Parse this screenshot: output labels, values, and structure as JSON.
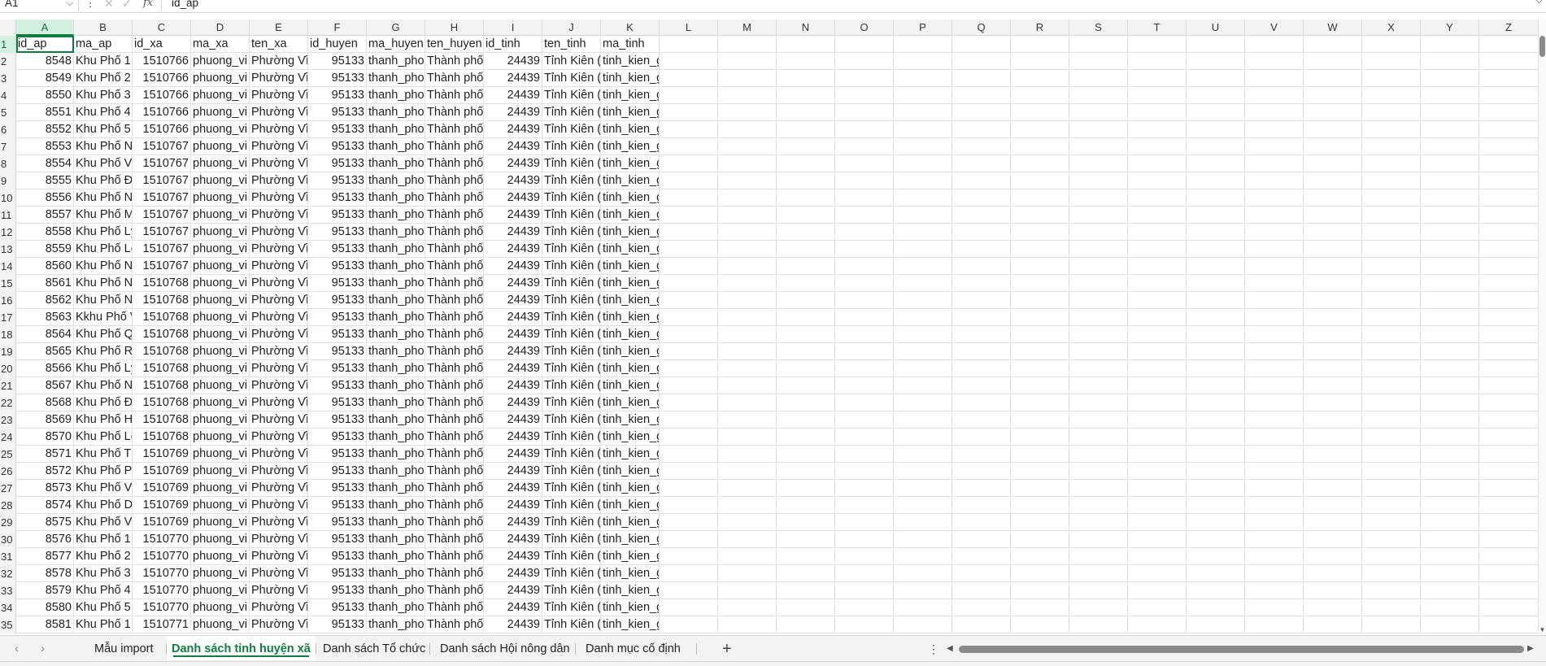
{
  "formula_bar": {
    "name_box": "A1",
    "formula": "id_ap",
    "dots": "⋮",
    "cancel_icon": "close-icon",
    "enter_icon": "check-icon",
    "fx_label": "fx"
  },
  "columns": [
    "A",
    "B",
    "C",
    "D",
    "E",
    "F",
    "G",
    "H",
    "I",
    "J",
    "K",
    "L",
    "M",
    "N",
    "O",
    "P",
    "Q",
    "R",
    "S",
    "T",
    "U",
    "V",
    "W",
    "X",
    "Y",
    "Z"
  ],
  "headers": [
    "id_ap",
    "ma_ap",
    "id_xa",
    "ma_xa",
    "ten_xa",
    "id_huyen",
    "ma_huyen",
    "ten_huyen",
    "id_tinh",
    "ten_tinh",
    "ma_tinh"
  ],
  "rows": [
    [
      "8548",
      "Khu Phố 1",
      "1510766",
      "phuong_vi",
      "Phường Vĩ",
      "95133",
      "thanh_pho",
      "Thành phố",
      "24439",
      "Tỉnh Kiên (",
      "tinh_kien_giang"
    ],
    [
      "8549",
      "Khu Phố 2",
      "1510766",
      "phuong_vi",
      "Phường Vĩ",
      "95133",
      "thanh_pho",
      "Thành phố",
      "24439",
      "Tỉnh Kiên (",
      "tinh_kien_giang"
    ],
    [
      "8550",
      "Khu Phố 3",
      "1510766",
      "phuong_vi",
      "Phường Vĩ",
      "95133",
      "thanh_pho",
      "Thành phố",
      "24439",
      "Tỉnh Kiên (",
      "tinh_kien_giang"
    ],
    [
      "8551",
      "Khu Phố 4",
      "1510766",
      "phuong_vi",
      "Phường Vĩ",
      "95133",
      "thanh_pho",
      "Thành phố",
      "24439",
      "Tỉnh Kiên (",
      "tinh_kien_giang"
    ],
    [
      "8552",
      "Khu Phố 5",
      "1510766",
      "phuong_vi",
      "Phường Vĩ",
      "95133",
      "thanh_pho",
      "Thành phố",
      "24439",
      "Tỉnh Kiên (",
      "tinh_kien_giang"
    ],
    [
      "8553",
      "Khu Phố Ng",
      "1510767",
      "phuong_vi",
      "Phường Vĩ",
      "95133",
      "thanh_pho",
      "Thành phố",
      "24439",
      "Tỉnh Kiên (",
      "tinh_kien_giang"
    ],
    [
      "8554",
      "Khu Phố Võ",
      "1510767",
      "phuong_vi",
      "Phường Vĩ",
      "95133",
      "thanh_pho",
      "Thành phố",
      "24439",
      "Tỉnh Kiên (",
      "tinh_kien_giang"
    ],
    [
      "8555",
      "Khu Phố Đỗ",
      "1510767",
      "phuong_vi",
      "Phường Vĩ",
      "95133",
      "thanh_pho",
      "Thành phố",
      "24439",
      "Tỉnh Kiên (",
      "tinh_kien_giang"
    ],
    [
      "8556",
      "Khu Phố Ng",
      "1510767",
      "phuong_vi",
      "Phường Vĩ",
      "95133",
      "thanh_pho",
      "Thành phố",
      "24439",
      "Tỉnh Kiên (",
      "tinh_kien_giang"
    ],
    [
      "8557",
      "Khu Phố M",
      "1510767",
      "phuong_vi",
      "Phường Vĩ",
      "95133",
      "thanh_pho",
      "Thành phố",
      "24439",
      "Tỉnh Kiên (",
      "tinh_kien_giang"
    ],
    [
      "8558",
      "Khu Phố Lý",
      "1510767",
      "phuong_vi",
      "Phường Vĩ",
      "95133",
      "thanh_pho",
      "Thành phố",
      "24439",
      "Tỉnh Kiên (",
      "tinh_kien_giang"
    ],
    [
      "8559",
      "Khu Phố Lê",
      "1510767",
      "phuong_vi",
      "Phường Vĩ",
      "95133",
      "thanh_pho",
      "Thành phố",
      "24439",
      "Tỉnh Kiên (",
      "tinh_kien_giang"
    ],
    [
      "8560",
      "Khu Phố Ng",
      "1510767",
      "phuong_vi",
      "Phường Vĩ",
      "95133",
      "thanh_pho",
      "Thành phố",
      "24439",
      "Tỉnh Kiên (",
      "tinh_kien_giang"
    ],
    [
      "8561",
      "Khu Phố Ng",
      "1510768",
      "phuong_vi",
      "Phường Vĩ",
      "95133",
      "thanh_pho",
      "Thành phố",
      "24439",
      "Tỉnh Kiên (",
      "tinh_kien_giang"
    ],
    [
      "8562",
      "Khu Phố Na",
      "1510768",
      "phuong_vi",
      "Phường Vĩ",
      "95133",
      "thanh_pho",
      "Thành phố",
      "24439",
      "Tỉnh Kiên (",
      "tinh_kien_giang"
    ],
    [
      "8563",
      "Kkhu Phố V",
      "1510768",
      "phuong_vi",
      "Phường Vĩ",
      "95133",
      "thanh_pho",
      "Thành phố",
      "24439",
      "Tỉnh Kiên (",
      "tinh_kien_giang"
    ],
    [
      "8564",
      "Khu Phố Qu",
      "1510768",
      "phuong_vi",
      "Phường Vĩ",
      "95133",
      "thanh_pho",
      "Thành phố",
      "24439",
      "Tỉnh Kiên (",
      "tinh_kien_giang"
    ],
    [
      "8565",
      "Khu Phố Ra",
      "1510768",
      "phuong_vi",
      "Phường Vĩ",
      "95133",
      "thanh_pho",
      "Thành phố",
      "24439",
      "Tỉnh Kiên (",
      "tinh_kien_giang"
    ],
    [
      "8566",
      "Khu Phố Lý",
      "1510768",
      "phuong_vi",
      "Phường Vĩ",
      "95133",
      "thanh_pho",
      "Thành phố",
      "24439",
      "Tỉnh Kiên (",
      "tinh_kien_giang"
    ],
    [
      "8567",
      "Khu Phố Ng",
      "1510768",
      "phuong_vi",
      "Phường Vĩ",
      "95133",
      "thanh_pho",
      "Thành phố",
      "24439",
      "Tỉnh Kiên (",
      "tinh_kien_giang"
    ],
    [
      "8568",
      "Khu Phố Đề",
      "1510768",
      "phuong_vi",
      "Phường Vĩ",
      "95133",
      "thanh_pho",
      "Thành phố",
      "24439",
      "Tỉnh Kiên (",
      "tinh_kien_giang"
    ],
    [
      "8569",
      "Khu Phố Hu",
      "1510768",
      "phuong_vi",
      "Phường Vĩ",
      "95133",
      "thanh_pho",
      "Thành phố",
      "24439",
      "Tỉnh Kiên (",
      "tinh_kien_giang"
    ],
    [
      "8570",
      "Khu Phố Lê",
      "1510768",
      "phuong_vi",
      "Phường Vĩ",
      "95133",
      "thanh_pho",
      "Thành phố",
      "24439",
      "Tỉnh Kiên (",
      "tinh_kien_giang"
    ],
    [
      "8571",
      "Khu Phố Th",
      "1510769",
      "phuong_vi",
      "Phường Vĩ",
      "95133",
      "thanh_pho",
      "Thành phố",
      "24439",
      "Tỉnh Kiên (",
      "tinh_kien_giang"
    ],
    [
      "8572",
      "Khu Phố Ph",
      "1510769",
      "phuong_vi",
      "Phường Vĩ",
      "95133",
      "thanh_pho",
      "Thành phố",
      "24439",
      "Tỉnh Kiên (",
      "tinh_kien_giang"
    ],
    [
      "8573",
      "Khu Phố Vĩ",
      "1510769",
      "phuong_vi",
      "Phường Vĩ",
      "95133",
      "thanh_pho",
      "Thành phố",
      "24439",
      "Tỉnh Kiên (",
      "tinh_kien_giang"
    ],
    [
      "8574",
      "Khu Phố Dầ",
      "1510769",
      "phuong_vi",
      "Phường Vĩ",
      "95133",
      "thanh_pho",
      "Thành phố",
      "24439",
      "Tỉnh Kiên (",
      "tinh_kien_giang"
    ],
    [
      "8575",
      "Khu Phố Vĩ",
      "1510769",
      "phuong_vi",
      "Phường Vĩ",
      "95133",
      "thanh_pho",
      "Thành phố",
      "24439",
      "Tỉnh Kiên (",
      "tinh_kien_giang"
    ],
    [
      "8576",
      "Khu Phố 1",
      "1510770",
      "phuong_vi",
      "Phường Vĩ",
      "95133",
      "thanh_pho",
      "Thành phố",
      "24439",
      "Tỉnh Kiên (",
      "tinh_kien_giang"
    ],
    [
      "8577",
      "Khu Phố 2",
      "1510770",
      "phuong_vi",
      "Phường Vĩ",
      "95133",
      "thanh_pho",
      "Thành phố",
      "24439",
      "Tỉnh Kiên (",
      "tinh_kien_giang"
    ],
    [
      "8578",
      "Khu Phố 3",
      "1510770",
      "phuong_vi",
      "Phường Vĩ",
      "95133",
      "thanh_pho",
      "Thành phố",
      "24439",
      "Tỉnh Kiên (",
      "tinh_kien_giang"
    ],
    [
      "8579",
      "Khu Phố 4",
      "1510770",
      "phuong_vi",
      "Phường Vĩ",
      "95133",
      "thanh_pho",
      "Thành phố",
      "24439",
      "Tỉnh Kiên (",
      "tinh_kien_giang"
    ],
    [
      "8580",
      "Khu Phố 5",
      "1510770",
      "phuong_vi",
      "Phường Vĩ",
      "95133",
      "thanh_pho",
      "Thành phố",
      "24439",
      "Tỉnh Kiên (",
      "tinh_kien_giang"
    ],
    [
      "8581",
      "Khu Phố 1",
      "1510771",
      "phuong_vi",
      "Phường Vĩ",
      "95133",
      "thanh_pho",
      "Thành phố",
      "24439",
      "Tỉnh Kiên (",
      "tinh_kien_giang"
    ]
  ],
  "numeric_columns": [
    0,
    2,
    5,
    8
  ],
  "sheet_tabs": {
    "nav_prev": "‹",
    "nav_next": "›",
    "tabs": [
      "Mẫu import",
      "Danh sách tỉnh huyện xã",
      "Danh sách Tổ chức",
      "Danh sách Hội nông dân",
      "Danh mục cố định"
    ],
    "active_index": 1,
    "add_label": "+",
    "more_label": "⋮"
  },
  "colors": {
    "accent": "#107c41",
    "header_bg": "#f3f3f3",
    "selected_header_bg": "#d3f0e0"
  }
}
